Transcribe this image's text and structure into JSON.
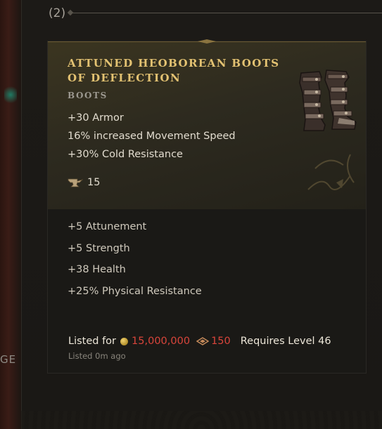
{
  "page": {
    "count_label": "(2)",
    "cutoff_text": "GE"
  },
  "item": {
    "name": "ATTUNED HEOBOREAN BOOTS OF DEFLECTION",
    "type": "BOOTS",
    "image_icon": "boots-icon",
    "implicit_stats": [
      "+30 Armor",
      "16% increased Movement Speed",
      "+30% Cold Resistance"
    ],
    "forging_potential_icon": "anvil-icon",
    "forging_potential": "15",
    "affixes": [
      "+5 Attunement",
      "+5 Strength",
      "+38 Health",
      "+25% Physical Resistance"
    ]
  },
  "listing": {
    "label": "Listed for",
    "currency_icon": "gold-coin-icon",
    "price": "15,000,000",
    "fade_icon": "favor-icon",
    "fade_value": "150",
    "requirement": "Requires Level 46",
    "listed_ago": "Listed 0m ago"
  },
  "colors": {
    "name": "#e3c272",
    "price": "#d9453b"
  }
}
